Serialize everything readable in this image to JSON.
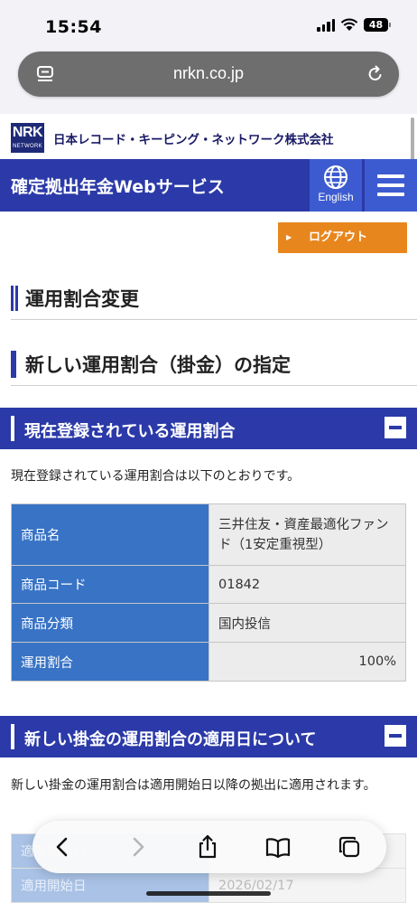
{
  "status_bar": {
    "time": "15:54",
    "battery": "48"
  },
  "browser": {
    "url": "nrkn.co.jp"
  },
  "header": {
    "logo_main": "NRK",
    "logo_sub": "NETWORK",
    "company_name": "日本レコード・キーピング・ネットワーク株式会社",
    "service_title": "確定拠出年金Webサービス",
    "english_label": "English"
  },
  "logout_label": "ログアウト",
  "page_title": "運用割合変更",
  "sub_title": "新しい運用割合（掛金）の指定",
  "current_section": {
    "title": "現在登録されている運用割合",
    "description": "現在登録されている運用割合は以下のとおりです。",
    "rows": [
      {
        "label": "商品名",
        "value": "三井住友・資産最適化ファンド（1安定重視型）"
      },
      {
        "label": "商品コード",
        "value": "01842"
      },
      {
        "label": "商品分類",
        "value": "国内投信"
      },
      {
        "label": "運用割合",
        "value": "100%"
      }
    ]
  },
  "apply_section": {
    "title": "新しい掛金の運用割合の適用日について",
    "description": "新しい掛金の運用割合は適用開始日以降の拠出に適用されます。",
    "rows": [
      {
        "label": "適用開始日",
        "value": "2026/02/17"
      }
    ]
  },
  "colors": {
    "brand_blue": "#2b3aa8",
    "table_header": "#3873c5",
    "logout": "#e8861e"
  }
}
